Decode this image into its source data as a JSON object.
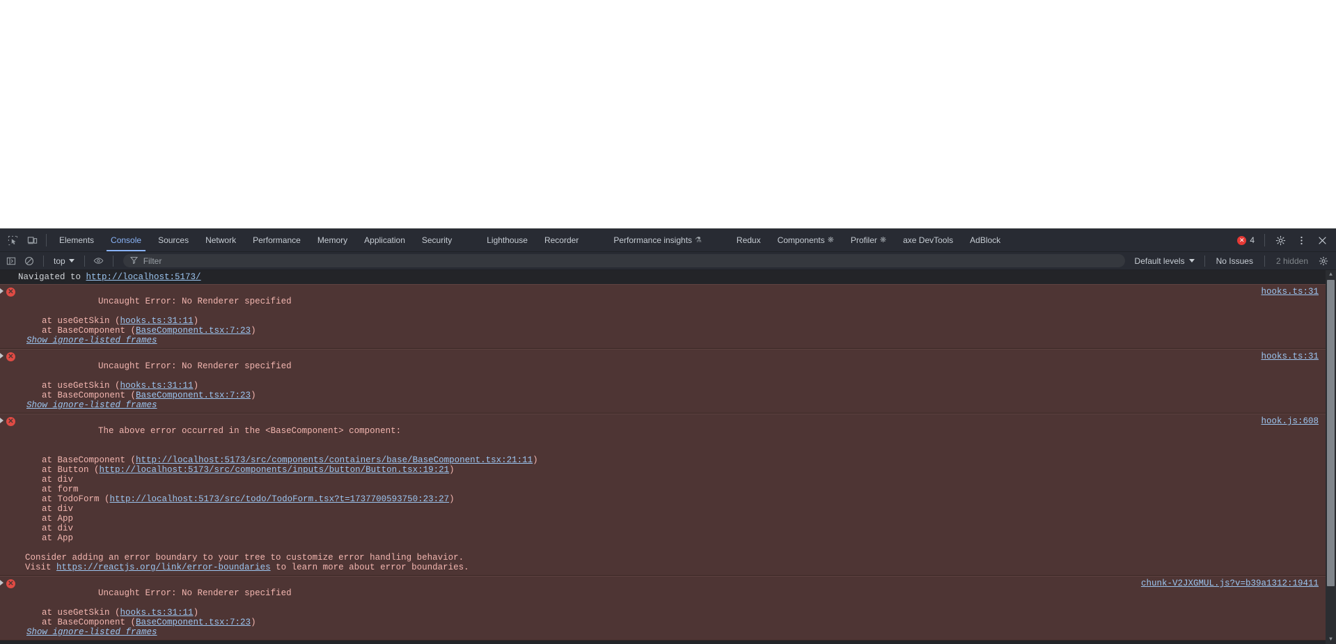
{
  "devtools": {
    "tabbar": {
      "icons": [
        {
          "name": "inspect-element-icon",
          "glyph": "inspect"
        },
        {
          "name": "device-toolbar-icon",
          "glyph": "device"
        }
      ],
      "tabs": [
        {
          "label": "Elements",
          "active": false,
          "icon": null
        },
        {
          "label": "Console",
          "active": true,
          "icon": null
        },
        {
          "label": "Sources",
          "active": false,
          "icon": null
        },
        {
          "label": "Network",
          "active": false,
          "icon": null
        },
        {
          "label": "Performance",
          "active": false,
          "icon": null
        },
        {
          "label": "Memory",
          "active": false,
          "icon": null
        },
        {
          "label": "Application",
          "active": false,
          "icon": null
        },
        {
          "label": "Security",
          "active": false,
          "icon": null
        },
        {
          "label": "Lighthouse",
          "active": false,
          "icon": null
        },
        {
          "label": "Recorder",
          "active": false,
          "icon": null
        },
        {
          "label": "Performance insights",
          "active": false,
          "icon": "⚗"
        },
        {
          "label": "Redux",
          "active": false,
          "icon": null
        },
        {
          "label": "Components",
          "active": false,
          "icon": "❋"
        },
        {
          "label": "Profiler",
          "active": false,
          "icon": "❋"
        },
        {
          "label": "axe DevTools",
          "active": false,
          "icon": null
        },
        {
          "label": "AdBlock",
          "active": false,
          "icon": null
        }
      ],
      "error_count": "4",
      "settings_label": "⚙",
      "more_label": "⋮",
      "close_label": "✕"
    },
    "console_toolbar": {
      "sidebar_toggle": "sidebar-icon",
      "clear_console": "clear-icon",
      "context": "top",
      "eye_icon": "eye-icon",
      "filter_placeholder": "Filter",
      "filter_value": "",
      "levels": "Default levels",
      "issues": "No Issues",
      "hidden": "2 hidden",
      "settings": "⚙"
    },
    "console": {
      "messages": [
        {
          "type": "info",
          "segments": [
            {
              "text": "Navigated to ",
              "kind": "text"
            },
            {
              "text": "http://localhost:5173/",
              "kind": "link"
            }
          ]
        },
        {
          "type": "error",
          "source": "hooks.ts:31",
          "lines": [
            {
              "cls": "head",
              "segments": [
                {
                  "text": "Uncaught Error: No Renderer specified",
                  "kind": "text"
                }
              ]
            },
            {
              "cls": "stack",
              "segments": [
                {
                  "text": "at useGetSkin (",
                  "kind": "text"
                },
                {
                  "text": "hooks.ts:31:11",
                  "kind": "link"
                },
                {
                  "text": ")",
                  "kind": "text"
                }
              ]
            },
            {
              "cls": "stack",
              "segments": [
                {
                  "text": "at BaseComponent (",
                  "kind": "text"
                },
                {
                  "text": "BaseComponent.tsx:7:23",
                  "kind": "link"
                },
                {
                  "text": ")",
                  "kind": "text"
                }
              ]
            }
          ],
          "ignore_link": "Show ignore-listed frames"
        },
        {
          "type": "error",
          "source": "hooks.ts:31",
          "lines": [
            {
              "cls": "head",
              "segments": [
                {
                  "text": "Uncaught Error: No Renderer specified",
                  "kind": "text"
                }
              ]
            },
            {
              "cls": "stack",
              "segments": [
                {
                  "text": "at useGetSkin (",
                  "kind": "text"
                },
                {
                  "text": "hooks.ts:31:11",
                  "kind": "link"
                },
                {
                  "text": ")",
                  "kind": "text"
                }
              ]
            },
            {
              "cls": "stack",
              "segments": [
                {
                  "text": "at BaseComponent (",
                  "kind": "text"
                },
                {
                  "text": "BaseComponent.tsx:7:23",
                  "kind": "link"
                },
                {
                  "text": ")",
                  "kind": "text"
                }
              ]
            }
          ],
          "ignore_link": "Show ignore-listed frames"
        },
        {
          "type": "error",
          "source": "hook.js:608",
          "lines": [
            {
              "cls": "head",
              "segments": [
                {
                  "text": "The above error occurred in the <BaseComponent> component:",
                  "kind": "text"
                }
              ]
            },
            {
              "cls": "blank",
              "segments": []
            },
            {
              "cls": "stack",
              "segments": [
                {
                  "text": "at BaseComponent (",
                  "kind": "text"
                },
                {
                  "text": "http://localhost:5173/src/components/containers/base/BaseComponent.tsx:21:11",
                  "kind": "link"
                },
                {
                  "text": ")",
                  "kind": "text"
                }
              ]
            },
            {
              "cls": "stack",
              "segments": [
                {
                  "text": "at Button (",
                  "kind": "text"
                },
                {
                  "text": "http://localhost:5173/src/components/inputs/button/Button.tsx:19:21",
                  "kind": "link"
                },
                {
                  "text": ")",
                  "kind": "text"
                }
              ]
            },
            {
              "cls": "stack",
              "segments": [
                {
                  "text": "at div",
                  "kind": "text"
                }
              ]
            },
            {
              "cls": "stack",
              "segments": [
                {
                  "text": "at form",
                  "kind": "text"
                }
              ]
            },
            {
              "cls": "stack",
              "segments": [
                {
                  "text": "at TodoForm (",
                  "kind": "text"
                },
                {
                  "text": "http://localhost:5173/src/todo/TodoForm.tsx?t=1737700593750:23:27",
                  "kind": "link"
                },
                {
                  "text": ")",
                  "kind": "text"
                }
              ]
            },
            {
              "cls": "stack",
              "segments": [
                {
                  "text": "at div",
                  "kind": "text"
                }
              ]
            },
            {
              "cls": "stack",
              "segments": [
                {
                  "text": "at App",
                  "kind": "text"
                }
              ]
            },
            {
              "cls": "stack",
              "segments": [
                {
                  "text": "at div",
                  "kind": "text"
                }
              ]
            },
            {
              "cls": "stack",
              "segments": [
                {
                  "text": "at App",
                  "kind": "text"
                }
              ]
            },
            {
              "cls": "blank",
              "segments": []
            },
            {
              "cls": "plain",
              "segments": [
                {
                  "text": "Consider adding an error boundary to your tree to customize error handling behavior.",
                  "kind": "text"
                }
              ]
            },
            {
              "cls": "plain",
              "segments": [
                {
                  "text": "Visit ",
                  "kind": "text"
                },
                {
                  "text": "https://reactjs.org/link/error-boundaries",
                  "kind": "link"
                },
                {
                  "text": " to learn more about error boundaries.",
                  "kind": "text"
                }
              ]
            }
          ],
          "ignore_link": null
        },
        {
          "type": "error",
          "source": "chunk-V2JXGMUL.js?v=b39a1312:19411",
          "lines": [
            {
              "cls": "head",
              "segments": [
                {
                  "text": "Uncaught Error: No Renderer specified",
                  "kind": "text"
                }
              ]
            },
            {
              "cls": "stack",
              "segments": [
                {
                  "text": "at useGetSkin (",
                  "kind": "text"
                },
                {
                  "text": "hooks.ts:31:11",
                  "kind": "link"
                },
                {
                  "text": ")",
                  "kind": "text"
                }
              ]
            },
            {
              "cls": "stack",
              "segments": [
                {
                  "text": "at BaseComponent (",
                  "kind": "text"
                },
                {
                  "text": "BaseComponent.tsx:7:23",
                  "kind": "link"
                },
                {
                  "text": ")",
                  "kind": "text"
                }
              ]
            }
          ],
          "ignore_link": "Show ignore-listed frames"
        }
      ]
    }
  },
  "colors": {
    "error_bg": "#4e3534",
    "error_text": "#f3b6b0",
    "link": "#9cc5f0",
    "accent": "#8ab4f8",
    "console_bg": "#232428",
    "chrome_bg": "#282b33"
  }
}
